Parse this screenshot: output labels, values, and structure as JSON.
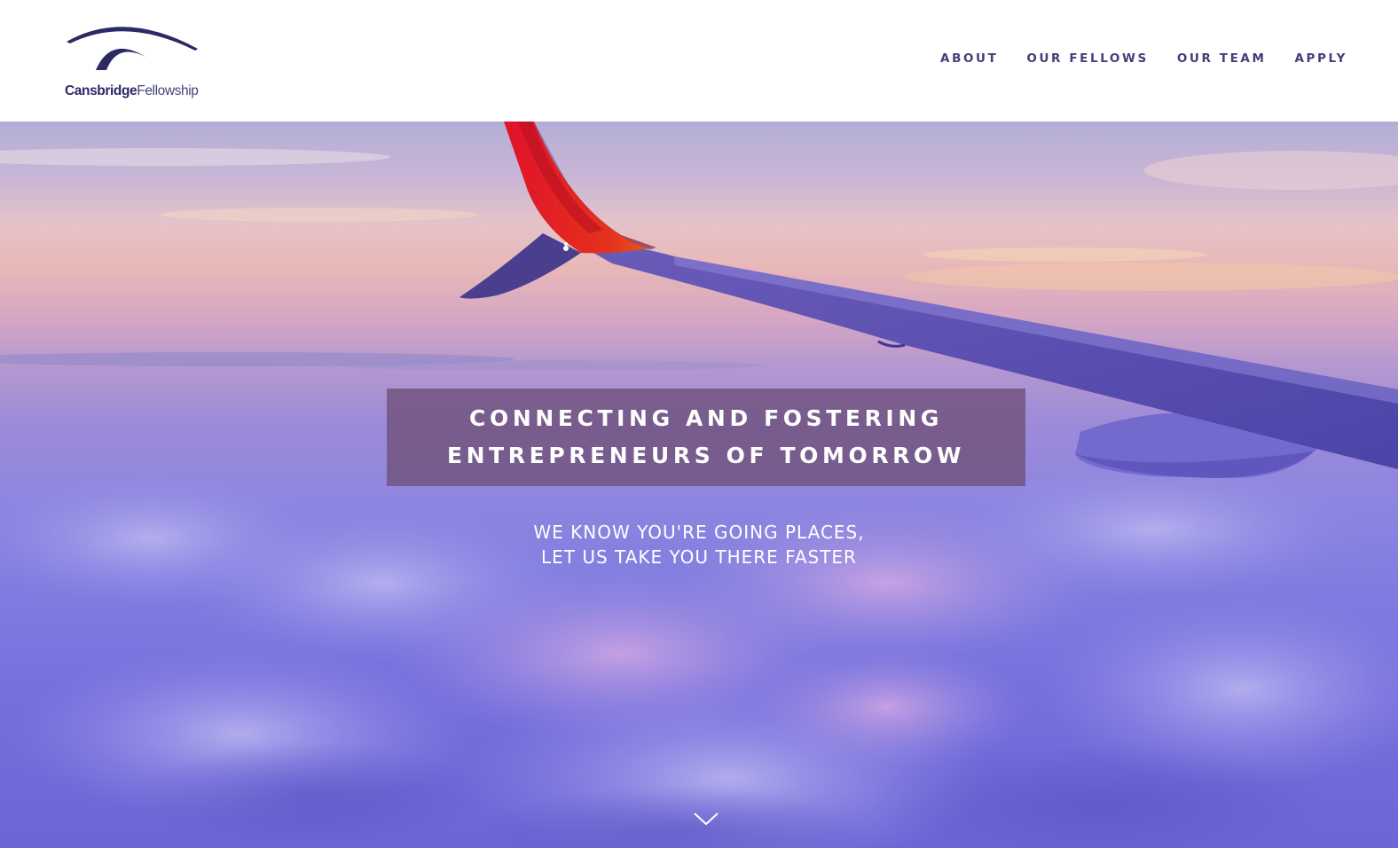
{
  "header": {
    "logo": {
      "name_bold": "Cansbridge",
      "name_light": "Fellowship",
      "icon": "arches-logo-icon",
      "color": "#2b2966"
    },
    "nav": [
      {
        "label": "ABOUT"
      },
      {
        "label": "OUR FELLOWS"
      },
      {
        "label": "OUR TEAM"
      },
      {
        "label": "APPLY"
      }
    ],
    "nav_color": "#4a3a7a"
  },
  "hero": {
    "background": "airplane-wing-over-purple-clouds",
    "headline": {
      "line1": "CONNECTING AND FOSTERING",
      "line2": "ENTREPRENEURS OF TOMORROW"
    },
    "tagline": {
      "line1": "WE KNOW YOU'RE GOING PLACES,",
      "line2": "LET US TAKE YOU THERE FASTER"
    },
    "scroll_icon": "chevron-down-icon",
    "overlay_color": "#6e5078"
  }
}
